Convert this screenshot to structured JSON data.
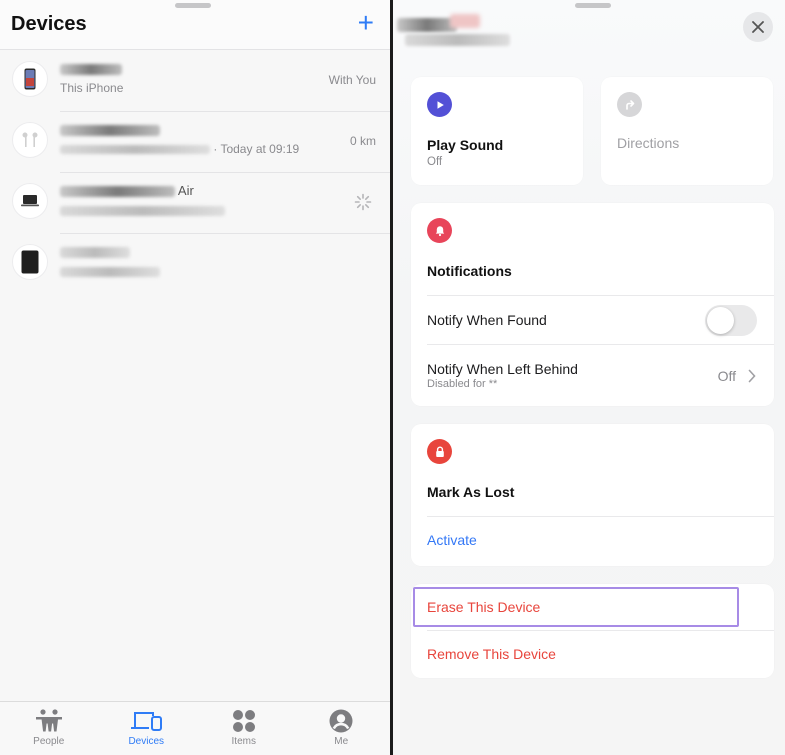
{
  "left": {
    "header": {
      "title": "Devices",
      "add_icon": "plus-icon"
    },
    "devices": [
      {
        "icon": "iphone-icon",
        "name": "",
        "subtitle": "This iPhone",
        "status": "With You"
      },
      {
        "icon": "airpods-icon",
        "name": "",
        "subtitle": "· Today at 09:19",
        "status": "0 km"
      },
      {
        "icon": "macbook-icon",
        "name": "Air",
        "subtitle": "",
        "status_icon": "loading-spinner-icon"
      },
      {
        "icon": "ipad-icon",
        "name": "",
        "subtitle": "",
        "status": ""
      }
    ],
    "tabs": [
      {
        "label": "People",
        "icon": "people-icon",
        "active": false
      },
      {
        "label": "Devices",
        "icon": "devices-icon",
        "active": true
      },
      {
        "label": "Items",
        "icon": "items-icon",
        "active": false
      },
      {
        "label": "Me",
        "icon": "me-icon",
        "active": false
      }
    ]
  },
  "right": {
    "close_icon": "close-icon",
    "play_sound": {
      "title": "Play Sound",
      "subtitle": "Off",
      "icon": "play-icon"
    },
    "directions": {
      "title": "Directions",
      "icon": "directions-icon"
    },
    "notifications": {
      "title": "Notifications",
      "icon": "bell-icon",
      "notify_when_found": {
        "label": "Notify When Found",
        "enabled": false
      },
      "notify_left_behind": {
        "label": "Notify When Left Behind",
        "sublabel": "Disabled for **",
        "value": "Off"
      }
    },
    "mark_as_lost": {
      "title": "Mark As Lost",
      "icon": "lock-icon",
      "action": "Activate"
    },
    "danger": {
      "erase": "Erase This Device",
      "remove": "Remove This Device"
    }
  },
  "colors": {
    "accent": "#3478f6",
    "play": "#5350d6",
    "notify": "#e8455a",
    "lost": "#e8453c",
    "destructive": "#e8453c",
    "highlight": "#a78be6"
  }
}
